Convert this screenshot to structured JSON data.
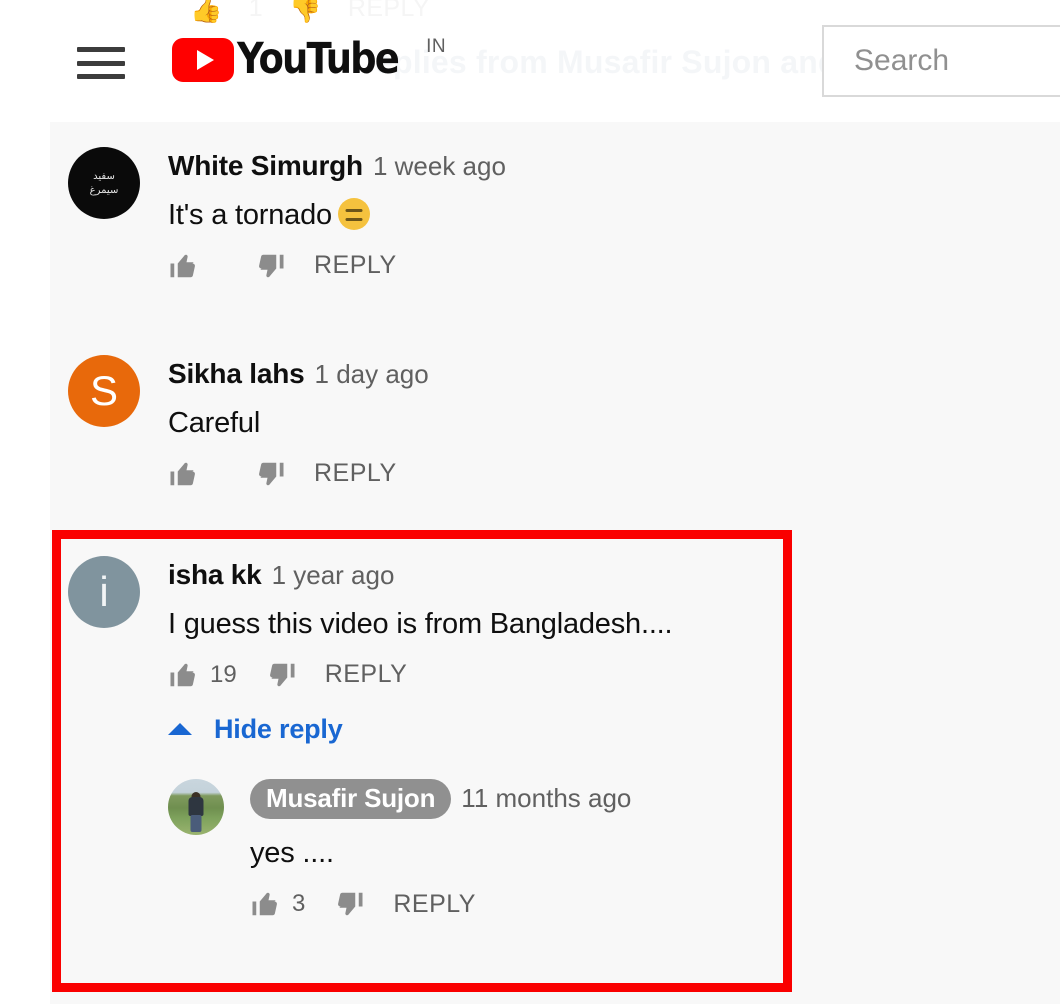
{
  "header": {
    "menu_icon": "hamburger-menu-icon",
    "logo_text": "YouTube",
    "logo_superscript": "IN",
    "logo_play_icon": "play-triangle-icon",
    "search_placeholder": "Search",
    "search_value": ""
  },
  "ghost": {
    "like_icon": "thumbs-up-icon",
    "like_count": "1",
    "dislike_icon": "thumbs-down-icon",
    "reply_label": "REPLY",
    "replies_line": "eplies from Musafir Sujon and"
  },
  "comments": [
    {
      "author": "White Simurgh",
      "timestamp": "1 week ago",
      "text": "It's a tornado",
      "emoji": "expressionless-face",
      "like_count": "",
      "reply_label": "REPLY",
      "avatar": {
        "type": "initial-black",
        "line1": "سفید",
        "line2": "سیمرغ"
      }
    },
    {
      "author": "Sikha lahs",
      "timestamp": "1 day ago",
      "text": "Careful",
      "like_count": "",
      "reply_label": "REPLY",
      "avatar": {
        "type": "initial-orange",
        "initial": "S"
      }
    },
    {
      "author": "isha kk",
      "timestamp": "1 year ago",
      "text": "I guess this video is from Bangladesh....",
      "like_count": "19",
      "reply_label": "REPLY",
      "hide_reply_label": "Hide reply",
      "avatar": {
        "type": "initial-slate",
        "initial": "i"
      },
      "reply": {
        "author": "Musafir Sujon",
        "author_is_chip": true,
        "timestamp": "11 months ago",
        "text": "yes ....",
        "like_count": "3",
        "reply_label": "REPLY",
        "avatar": {
          "type": "photo-person-field"
        }
      }
    }
  ],
  "annotation": {
    "highlight_color": "#fa0000",
    "highlight_target": "isha-kk-comment-thread"
  },
  "colors": {
    "brand_red": "#ff0000",
    "link_blue": "#1967d2",
    "panel_bg": "#f8f8f8",
    "text_primary": "#0f0f0f",
    "text_secondary": "#606060"
  }
}
